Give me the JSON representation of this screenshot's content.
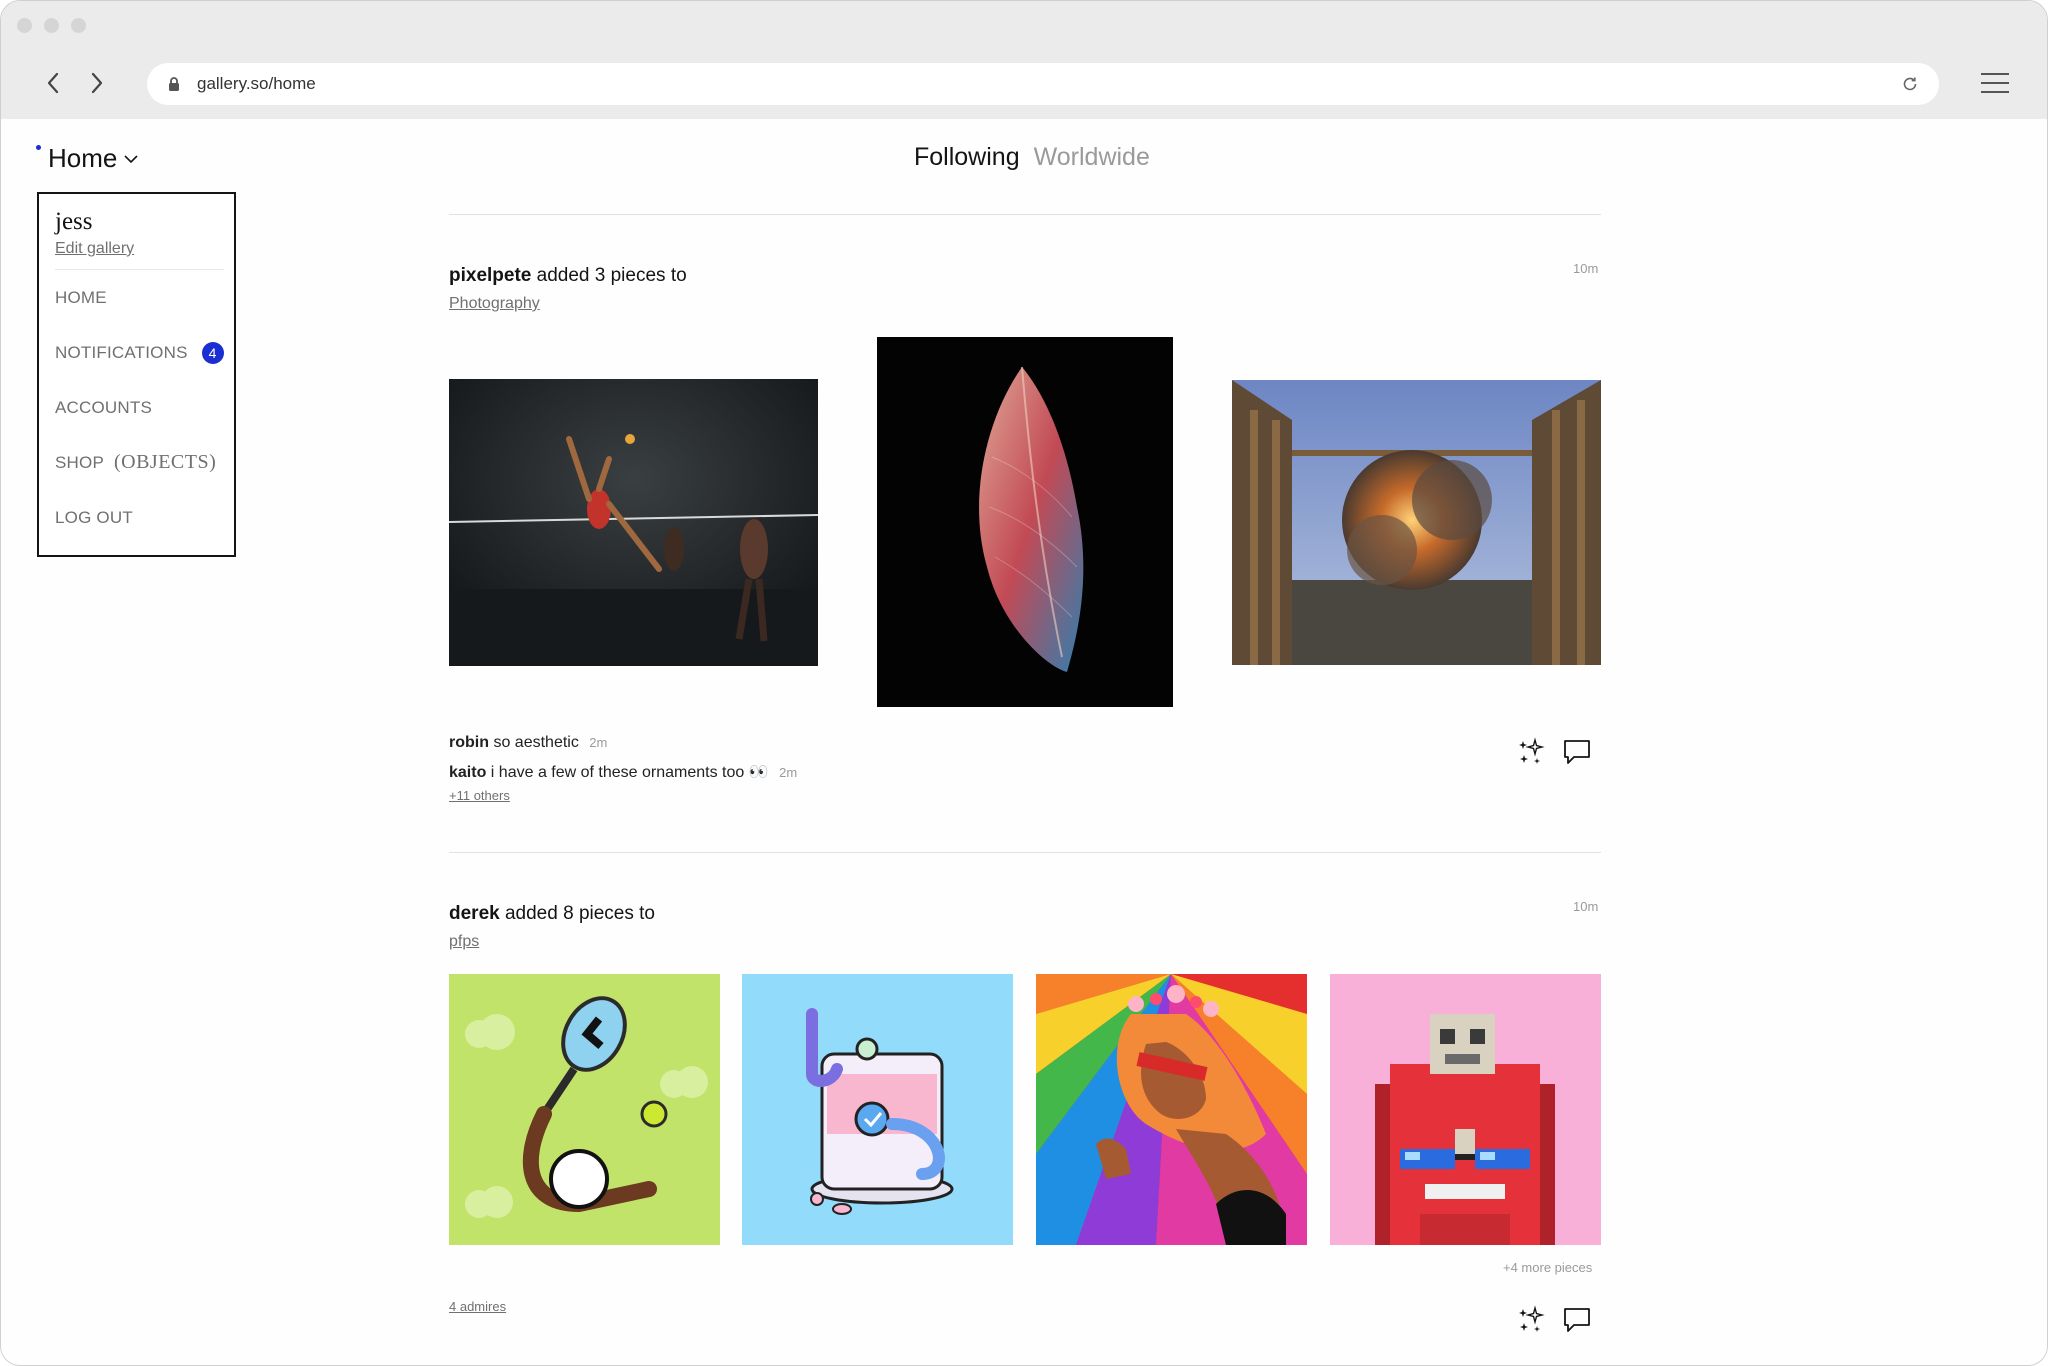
{
  "browser": {
    "url": "gallery.so/home"
  },
  "nav": {
    "home_label": "Home"
  },
  "side_menu": {
    "username": "jess",
    "edit_label": "Edit gallery",
    "items": {
      "home": "HOME",
      "notifications": "NOTIFICATIONS",
      "notifications_count": "4",
      "accounts": "ACCOUNTS",
      "shop": "SHOP",
      "shop_objects": "(OBJECTS)",
      "logout": "LOG OUT"
    }
  },
  "feed_tabs": {
    "following": "Following",
    "worldwide": "Worldwide"
  },
  "events": [
    {
      "user": "pixelpete",
      "action": "added 3 pieces to",
      "collection": "Photography",
      "time": "10m",
      "comments": [
        {
          "user": "robin",
          "text": "so aesthetic",
          "time": "2m"
        },
        {
          "user": "kaito",
          "text": "i have a few of these ornaments too 👀",
          "time": "2m"
        }
      ],
      "others": "+11 others"
    },
    {
      "user": "derek",
      "action": "added 8 pieces to",
      "collection": "pfps",
      "time": "10m",
      "more_pieces": "+4 more pieces",
      "admires": "4 admires"
    }
  ],
  "icons": {
    "admire": "sparkle-icon",
    "comment": "comment-icon",
    "accent_color": "#1a2ed2"
  }
}
